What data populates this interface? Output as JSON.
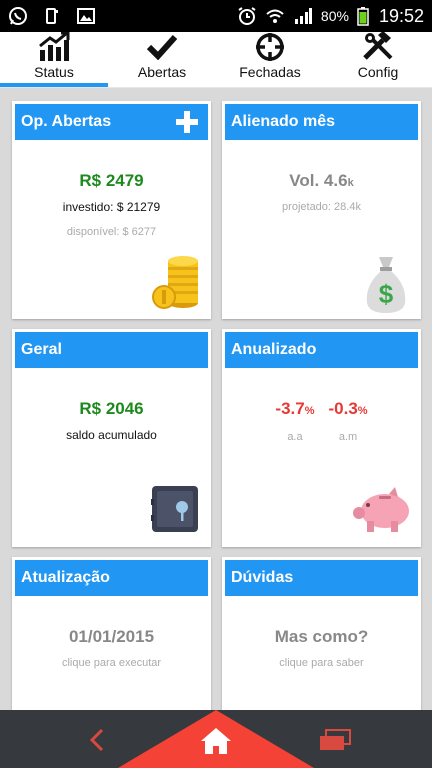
{
  "status_bar": {
    "battery": "80%",
    "time": "19:52"
  },
  "tabs": [
    {
      "label": "Status",
      "icon": "chart-up-icon",
      "active": true
    },
    {
      "label": "Abertas",
      "icon": "check-icon",
      "active": false
    },
    {
      "label": "Fechadas",
      "icon": "crosshair-icon",
      "active": false
    },
    {
      "label": "Config",
      "icon": "tools-icon",
      "active": false
    }
  ],
  "cards": {
    "op_abertas": {
      "title": "Op. Abertas",
      "value": "R$ 2479",
      "invested_label": "investido:",
      "invested_value": "$ 21279",
      "available_label": "disponível:",
      "available_value": "$ 6277",
      "icon": "coins-icon"
    },
    "alienado": {
      "title": "Alienado mês",
      "value": "Vol. 4.6",
      "value_unit": "k",
      "projected": "projetado: 28.4k",
      "icon": "money-bag-icon"
    },
    "geral": {
      "title": "Geral",
      "value": "R$ 2046",
      "caption": "saldo acumulado",
      "icon": "safe-icon"
    },
    "anualizado": {
      "title": "Anualizado",
      "value_aa": "-3.7",
      "value_am": "-0.3",
      "unit": "%",
      "label_aa": "a.a",
      "label_am": "a.m",
      "icon": "piggy-bank-icon"
    },
    "atualizacao": {
      "title": "Atualização",
      "value": "01/01/2015",
      "caption": "clique para executar"
    },
    "duvidas": {
      "title": "Dúvidas",
      "value": "Mas como?",
      "caption": "clique para saber"
    }
  },
  "colors": {
    "accent": "#2196f3",
    "positive": "#1e8a1e",
    "negative": "#e53935",
    "nav_home": "#f44336"
  }
}
